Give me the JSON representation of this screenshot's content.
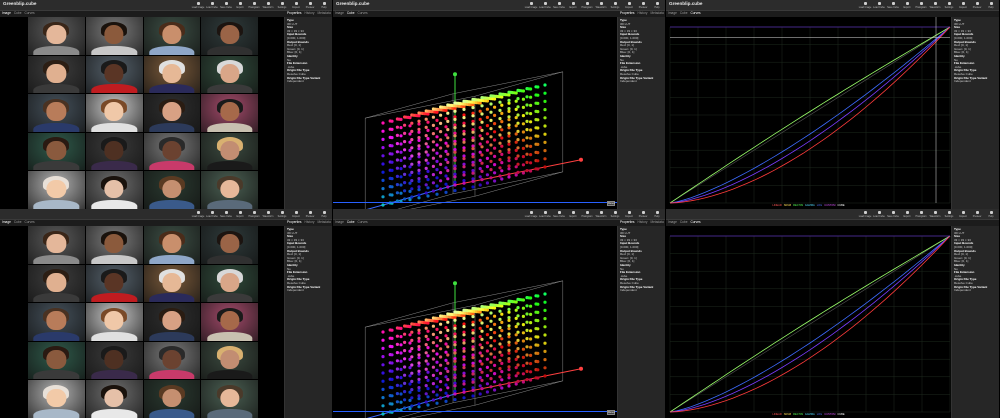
{
  "titles": {
    "r1": [
      "Greenblip.cube",
      "Greenblip.cube",
      "Greenblip.cube"
    ],
    "r2": [
      "",
      "",
      ""
    ]
  },
  "toolbar": [
    "Load Image",
    "Load Cube",
    "Save Cube",
    "Export",
    "Histogram",
    "Waveform",
    "Settings",
    "Inspect",
    "Preview",
    "Help"
  ],
  "tabs": [
    "Image",
    "Cube",
    "Curves"
  ],
  "panel_tabs": [
    "Properties",
    "History",
    "Metadata"
  ],
  "props": [
    {
      "t": "Type",
      "h": true
    },
    {
      "t": "3D LUT",
      "h": false
    },
    {
      "t": "Size",
      "h": true
    },
    {
      "t": "33 × 33 × 33",
      "h": false
    },
    {
      "t": "Input Bounds",
      "h": true
    },
    {
      "t": "[0.000, 1.000]",
      "h": false
    },
    {
      "t": "Output Bounds",
      "h": true
    },
    {
      "t": "Red: [0, 1]",
      "h": false
    },
    {
      "t": "Green: [0, 1]",
      "h": false
    },
    {
      "t": "Blue: [0, 1]",
      "h": false
    },
    {
      "t": "Identity",
      "h": true
    },
    {
      "t": "No",
      "h": false
    },
    {
      "t": "File Extension",
      "h": true
    },
    {
      "t": ".cube",
      "h": false
    },
    {
      "t": "Origin File Type",
      "h": true
    },
    {
      "t": "Resolve Cube",
      "h": false
    },
    {
      "t": "Origin File Type Variant",
      "h": true
    },
    {
      "t": "Independent",
      "h": false
    }
  ],
  "reset_label": "Reset",
  "legend": [
    "LINEAR",
    "SRGB",
    "REC709",
    "GAMMA",
    "LOG",
    "CUSTOM",
    "CUBE"
  ],
  "colors": {
    "red": "#ff3b3b",
    "green": "#4dff4d",
    "blue": "#3d6bff",
    "accent": "#2860ff"
  }
}
